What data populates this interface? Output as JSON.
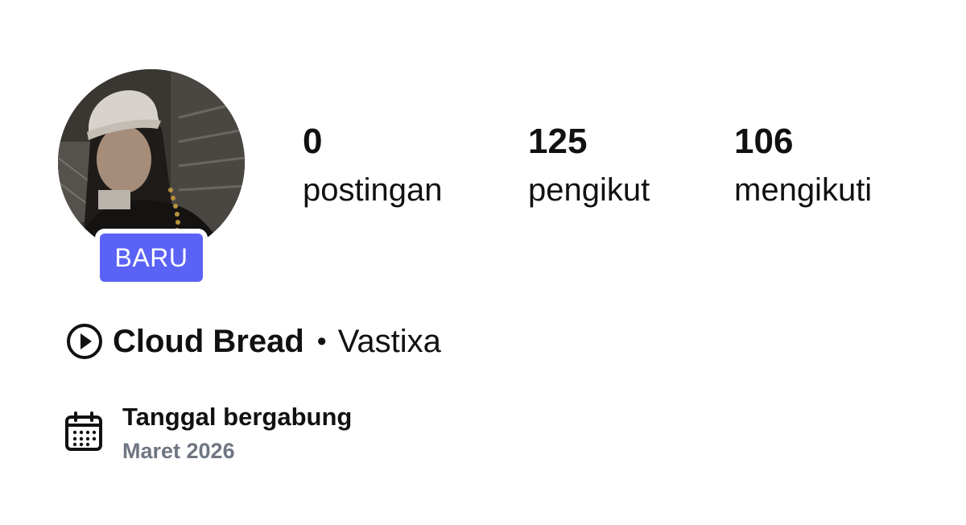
{
  "profile": {
    "badge_label": "BARU",
    "stats": [
      {
        "count": "0",
        "label": "postingan"
      },
      {
        "count": "125",
        "label": "pengikut"
      },
      {
        "count": "106",
        "label": "mengikuti"
      }
    ],
    "display_name": "Cloud Bread",
    "separator": "•",
    "username": "Vastixa",
    "joined_label": "Tanggal bergabung",
    "joined_date": "Maret 2026"
  },
  "icons": {
    "avatar": "profile-photo",
    "name_prefix": "play-circle-icon",
    "joined": "calendar-icon"
  },
  "colors": {
    "badge": "#5b63f6",
    "text_primary": "#111111",
    "text_secondary": "#6f7682",
    "background": "#ffffff"
  }
}
